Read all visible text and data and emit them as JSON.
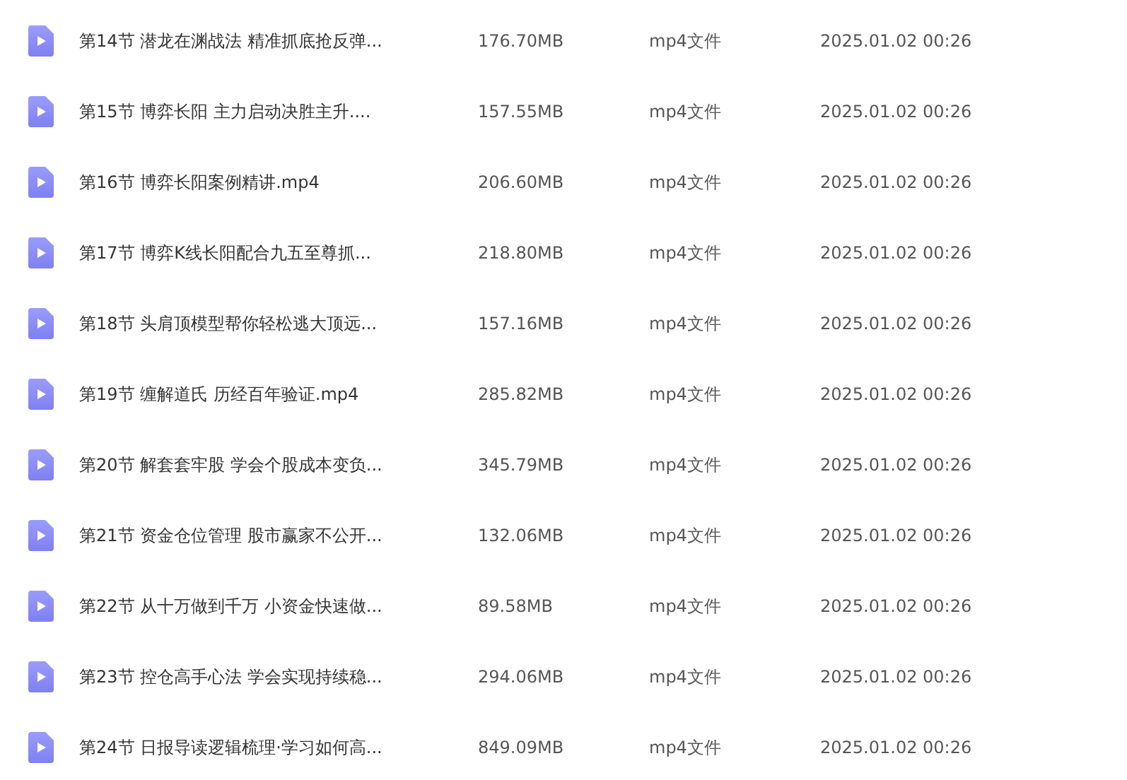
{
  "files": [
    {
      "name": "第14节 潜龙在渊战法 精准抓底抢反弹...",
      "size": "176.70MB",
      "type": "mp4文件",
      "modified": "2025.01.02 00:26"
    },
    {
      "name": "第15节 博弈长阳 主力启动决胜主升....",
      "size": "157.55MB",
      "type": "mp4文件",
      "modified": "2025.01.02 00:26"
    },
    {
      "name": "第16节 博弈长阳案例精讲.mp4",
      "size": "206.60MB",
      "type": "mp4文件",
      "modified": "2025.01.02 00:26"
    },
    {
      "name": "第17节 博弈K线长阳配合九五至尊抓...",
      "size": "218.80MB",
      "type": "mp4文件",
      "modified": "2025.01.02 00:26"
    },
    {
      "name": "第18节 头肩顶模型帮你轻松逃大顶远...",
      "size": "157.16MB",
      "type": "mp4文件",
      "modified": "2025.01.02 00:26"
    },
    {
      "name": "第19节 缠解道氏 历经百年验证.mp4",
      "size": "285.82MB",
      "type": "mp4文件",
      "modified": "2025.01.02 00:26"
    },
    {
      "name": "第20节 解套套牢股 学会个股成本变负...",
      "size": "345.79MB",
      "type": "mp4文件",
      "modified": "2025.01.02 00:26"
    },
    {
      "name": "第21节 资金仓位管理 股市赢家不公开...",
      "size": "132.06MB",
      "type": "mp4文件",
      "modified": "2025.01.02 00:26"
    },
    {
      "name": "第22节 从十万做到千万 小资金快速做...",
      "size": "89.58MB",
      "type": "mp4文件",
      "modified": "2025.01.02 00:26"
    },
    {
      "name": "第23节 控仓高手心法 学会实现持续稳...",
      "size": "294.06MB",
      "type": "mp4文件",
      "modified": "2025.01.02 00:26"
    },
    {
      "name": "第24节 日报导读逻辑梳理·学习如何高...",
      "size": "849.09MB",
      "type": "mp4文件",
      "modified": "2025.01.02 00:26"
    }
  ]
}
